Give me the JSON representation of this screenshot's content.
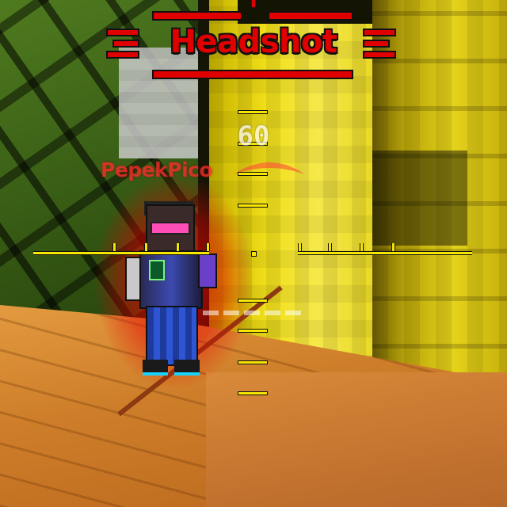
{
  "hud": {
    "kill_banner": "Headshot",
    "ammo_count": "60",
    "crosshair_color": "#f7e600",
    "banner_color": "#e00000"
  },
  "enemy": {
    "name": "PepekPico",
    "name_color": "#ff2a2a"
  },
  "icons": [
    "skull-emblem-icon",
    "crosshair-icon"
  ]
}
